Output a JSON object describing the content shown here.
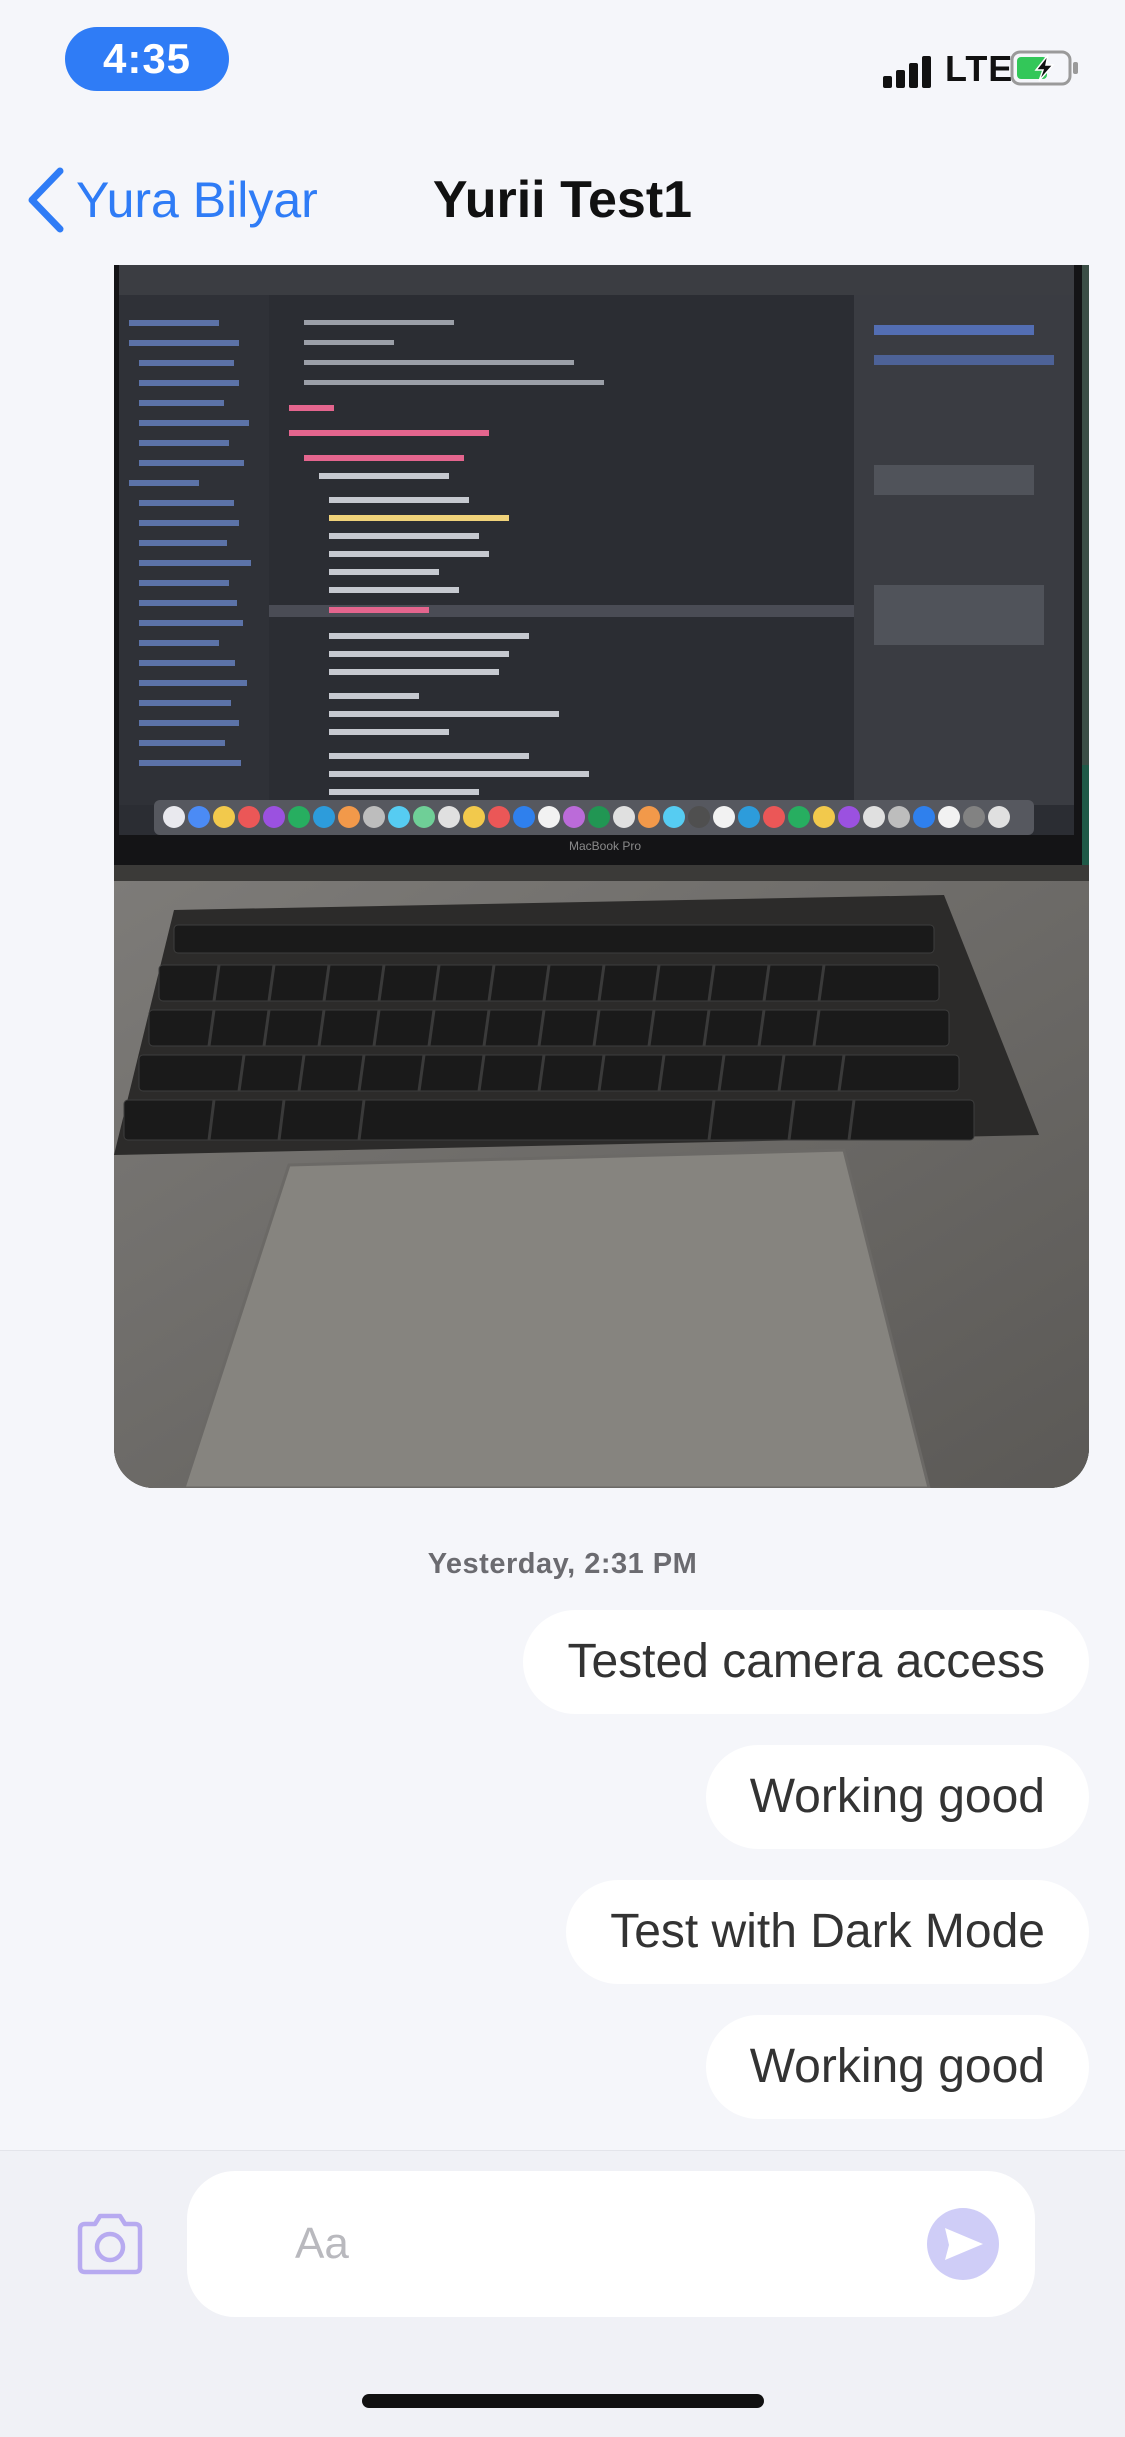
{
  "status_bar": {
    "time": "4:35",
    "network": "LTE",
    "battery_icon": "battery-charging-icon",
    "signal_icon": "signal-bars-icon"
  },
  "nav": {
    "back_label": "Yura Bilyar",
    "title": "Yurii Test1"
  },
  "photo": {
    "description_icon": "photo-attachment",
    "laptop_label": "MacBook Pro",
    "code_lines": [
      "import UIKit",
      "class InsertableTextField: UITextField {",
      "override init(frame: CGRect) {",
      "super.init(frame: frame)",
      "backgroundColor = .white",
      "placeholder = \"Write something here ..\"",
      "font = UIFont.systemFont(ofSize: 14)",
      "clearButtonMode = .whileEditing",
      "borderStyle = .none",
      "layer.cornerRadius = 18",
      "layer.masksToBounds = true",
      "textColor = .black"
    ]
  },
  "messages": {
    "timestamp": "Yesterday, 2:31 PM",
    "items": [
      {
        "text": "Tested camera access"
      },
      {
        "text": "Working good"
      },
      {
        "text": "Test with Dark Mode"
      },
      {
        "text": "Working good"
      }
    ]
  },
  "composer": {
    "placeholder": "Aa",
    "camera_icon": "camera-icon",
    "send_icon": "send-icon",
    "accent": "#8f86ee"
  },
  "colors": {
    "accent": "#2f7cf6",
    "background": "#f5f6fa",
    "bubble": "#ffffff"
  }
}
